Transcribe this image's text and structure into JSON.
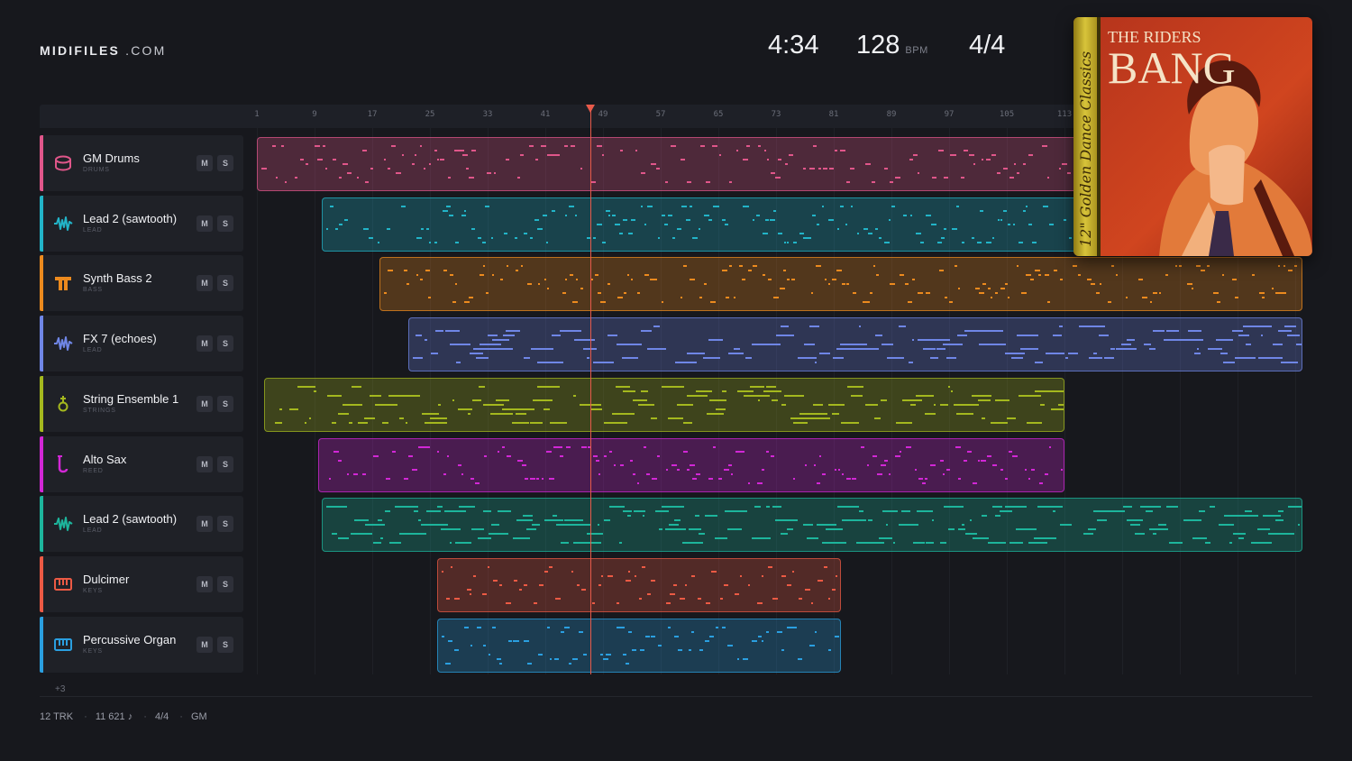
{
  "brand": {
    "name_bold": "MIDIFILES",
    "name_suffix": ".COM"
  },
  "transport": {
    "time": "4:34",
    "bpm": "128",
    "bpm_unit": "BPM",
    "signature": "4/4"
  },
  "ruler": {
    "ticks": [
      "1",
      "9",
      "17",
      "25",
      "33",
      "41",
      "49",
      "57",
      "65",
      "73",
      "81",
      "89",
      "97",
      "105",
      "113"
    ]
  },
  "tracks": [
    {
      "name": "GM Drums",
      "category": "DRUMS",
      "color": "#e0568a",
      "icon": "drum-icon",
      "mute": "M",
      "solo": "S"
    },
    {
      "name": "Lead 2 (sawtooth)",
      "category": "LEAD",
      "color": "#22b4c8",
      "icon": "waveform-icon",
      "mute": "M",
      "solo": "S"
    },
    {
      "name": "Synth Bass 2",
      "category": "BASS",
      "color": "#ec8a1e",
      "icon": "bass-amp-icon",
      "mute": "M",
      "solo": "S"
    },
    {
      "name": "FX 7 (echoes)",
      "category": "LEAD",
      "color": "#6f86e6",
      "icon": "waveform-icon",
      "mute": "M",
      "solo": "S"
    },
    {
      "name": "String Ensemble 1",
      "category": "STRINGS",
      "color": "#a4b81e",
      "icon": "violin-icon",
      "mute": "M",
      "solo": "S"
    },
    {
      "name": "Alto Sax",
      "category": "REED",
      "color": "#d227d6",
      "icon": "saxophone-icon",
      "mute": "M",
      "solo": "S"
    },
    {
      "name": "Lead 2 (sawtooth)",
      "category": "LEAD",
      "color": "#1db59c",
      "icon": "waveform-icon",
      "mute": "M",
      "solo": "S"
    },
    {
      "name": "Dulcimer",
      "category": "KEYS",
      "color": "#ec5a44",
      "icon": "piano-keys-icon",
      "mute": "M",
      "solo": "S"
    },
    {
      "name": "Percussive Organ",
      "category": "KEYS",
      "color": "#2a9fe0",
      "icon": "piano-keys-icon",
      "mute": "M",
      "solo": "S"
    }
  ],
  "more_tracks": "+3",
  "footer": {
    "tracks": "12 TRK",
    "notes": "11 621 ♪",
    "signature": "4/4",
    "standard": "GM"
  },
  "album": {
    "artist": "THE RIDERS",
    "title": "BANG",
    "spine": "12\" Golden Dance Classics"
  }
}
